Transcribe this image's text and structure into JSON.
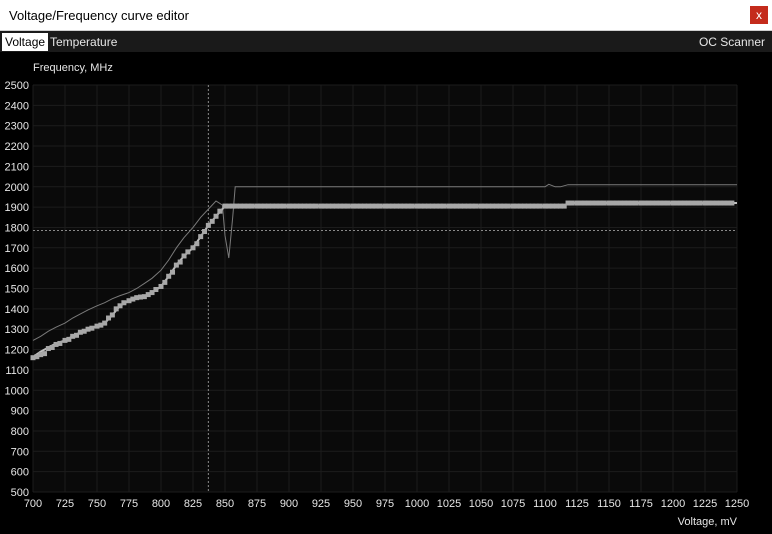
{
  "window": {
    "title": "Voltage/Frequency curve editor",
    "close_label": "x"
  },
  "tabs": {
    "voltage": "Voltage",
    "temperature": "Temperature",
    "oc_scanner": "OC Scanner"
  },
  "chart_data": {
    "type": "line",
    "ylabel": "Frequency, MHz",
    "xlabel": "Voltage, mV",
    "xlim": [
      700,
      1250
    ],
    "ylim": [
      500,
      2500
    ],
    "x_ticks": [
      700,
      725,
      750,
      775,
      800,
      825,
      850,
      875,
      900,
      925,
      950,
      975,
      1000,
      1025,
      1050,
      1075,
      1100,
      1125,
      1150,
      1175,
      1200,
      1225,
      1250
    ],
    "y_ticks": [
      500,
      600,
      700,
      800,
      900,
      1000,
      1100,
      1200,
      1300,
      1400,
      1500,
      1600,
      1700,
      1800,
      1900,
      2000,
      2100,
      2200,
      2300,
      2400,
      2500
    ],
    "grid": true,
    "cursor": {
      "x": 837,
      "y": 1785
    },
    "colors": {
      "background": "#000000",
      "grid": "#1c1c1c",
      "curve": "#bfbfbf",
      "points": "#a8a8a8",
      "reference": "#7a7a7a",
      "crosshair": "#8a8a8a"
    },
    "series": [
      {
        "role": "reference",
        "x": [
          700,
          706,
          712,
          718,
          725,
          731,
          737,
          743,
          750,
          756,
          762,
          768,
          775,
          781,
          787,
          793,
          800,
          806,
          812,
          818,
          825,
          831,
          837,
          843,
          848,
          850,
          853,
          856,
          858,
          862,
          900,
          1000,
          1100,
          1103,
          1108,
          1112,
          1118,
          1125,
          1200,
          1250
        ],
        "y": [
          1245,
          1265,
          1290,
          1310,
          1330,
          1355,
          1375,
          1395,
          1415,
          1430,
          1450,
          1465,
          1480,
          1500,
          1525,
          1550,
          1590,
          1640,
          1700,
          1750,
          1800,
          1850,
          1890,
          1930,
          1910,
          1760,
          1650,
          1850,
          2000,
          2000,
          2000,
          2000,
          2000,
          2012,
          2000,
          2000,
          2010,
          2010,
          2010,
          2010
        ]
      },
      {
        "role": "curve",
        "x": [
          700,
          702,
          706,
          712,
          718,
          725,
          731,
          737,
          743,
          750,
          756,
          762,
          768,
          775,
          781,
          787,
          793,
          800,
          806,
          812,
          818,
          825,
          831,
          837,
          843,
          850,
          856,
          862,
          868,
          875,
          900,
          950,
          1000,
          1050,
          1100,
          1115,
          1118,
          1125,
          1150,
          1200,
          1250
        ],
        "y": [
          1160,
          1172,
          1190,
          1210,
          1230,
          1245,
          1265,
          1285,
          1300,
          1315,
          1330,
          1370,
          1415,
          1440,
          1455,
          1460,
          1480,
          1510,
          1560,
          1615,
          1660,
          1700,
          1755,
          1810,
          1855,
          1905,
          1905,
          1905,
          1905,
          1905,
          1905,
          1905,
          1905,
          1905,
          1905,
          1905,
          1920,
          1920,
          1920,
          1920,
          1920
        ]
      }
    ],
    "points": {
      "x": [
        700,
        703,
        706,
        709,
        712,
        715,
        718,
        721,
        725,
        728,
        731,
        734,
        737,
        740,
        743,
        746,
        750,
        753,
        756,
        759,
        762,
        765,
        768,
        771,
        775,
        778,
        781,
        784,
        787,
        790,
        793,
        796,
        800,
        803,
        806,
        809,
        812,
        815,
        818,
        821,
        825,
        828,
        831,
        834,
        837,
        840,
        843,
        846,
        850,
        853,
        856,
        859,
        862,
        865,
        868,
        871,
        875,
        878,
        881,
        884,
        887,
        890,
        893,
        896,
        900,
        903,
        906,
        909,
        912,
        915,
        918,
        921,
        925,
        928,
        931,
        934,
        937,
        940,
        943,
        946,
        950,
        953,
        956,
        959,
        962,
        965,
        968,
        971,
        975,
        978,
        981,
        984,
        987,
        990,
        993,
        996,
        1000,
        1003,
        1006,
        1009,
        1012,
        1015,
        1018,
        1021,
        1025,
        1028,
        1031,
        1034,
        1037,
        1040,
        1043,
        1046,
        1050,
        1053,
        1056,
        1059,
        1062,
        1065,
        1068,
        1071,
        1075,
        1078,
        1081,
        1084,
        1087,
        1090,
        1093,
        1096,
        1100,
        1103,
        1106,
        1109,
        1112,
        1115,
        1118,
        1121,
        1125,
        1128,
        1131,
        1134,
        1137,
        1140,
        1143,
        1146,
        1150,
        1153,
        1156,
        1159,
        1162,
        1165,
        1168,
        1171,
        1175,
        1178,
        1181,
        1184,
        1187,
        1190,
        1193,
        1196,
        1200,
        1203,
        1206,
        1209,
        1212,
        1215,
        1218,
        1221,
        1225,
        1228,
        1231,
        1234,
        1237,
        1240,
        1243,
        1246
      ],
      "y": [
        1160,
        1165,
        1175,
        1180,
        1205,
        1210,
        1225,
        1230,
        1245,
        1250,
        1265,
        1270,
        1285,
        1290,
        1300,
        1305,
        1315,
        1320,
        1330,
        1355,
        1370,
        1400,
        1415,
        1430,
        1440,
        1448,
        1455,
        1458,
        1460,
        1470,
        1480,
        1495,
        1510,
        1530,
        1560,
        1580,
        1615,
        1630,
        1660,
        1680,
        1700,
        1720,
        1755,
        1780,
        1810,
        1830,
        1855,
        1880,
        1905,
        1905,
        1905,
        1905,
        1905,
        1905,
        1905,
        1905,
        1905,
        1905,
        1905,
        1905,
        1905,
        1905,
        1905,
        1905,
        1905,
        1905,
        1905,
        1905,
        1905,
        1905,
        1905,
        1905,
        1905,
        1905,
        1905,
        1905,
        1905,
        1905,
        1905,
        1905,
        1905,
        1905,
        1905,
        1905,
        1905,
        1905,
        1905,
        1905,
        1905,
        1905,
        1905,
        1905,
        1905,
        1905,
        1905,
        1905,
        1905,
        1905,
        1905,
        1905,
        1905,
        1905,
        1905,
        1905,
        1905,
        1905,
        1905,
        1905,
        1905,
        1905,
        1905,
        1905,
        1905,
        1905,
        1905,
        1905,
        1905,
        1905,
        1905,
        1905,
        1905,
        1905,
        1905,
        1905,
        1905,
        1905,
        1905,
        1905,
        1905,
        1905,
        1905,
        1905,
        1905,
        1905,
        1920,
        1920,
        1920,
        1920,
        1920,
        1920,
        1920,
        1920,
        1920,
        1920,
        1920,
        1920,
        1920,
        1920,
        1920,
        1920,
        1920,
        1920,
        1920,
        1920,
        1920,
        1920,
        1920,
        1920,
        1920,
        1920,
        1920,
        1920,
        1920,
        1920,
        1920,
        1920,
        1920,
        1920,
        1920,
        1920,
        1920,
        1920,
        1920,
        1920,
        1920,
        1920,
        1920,
        1920,
        1920,
        1920,
        1920,
        1920,
        1920,
        1920,
        1920,
        1920,
        1920,
        1920
      ]
    }
  }
}
